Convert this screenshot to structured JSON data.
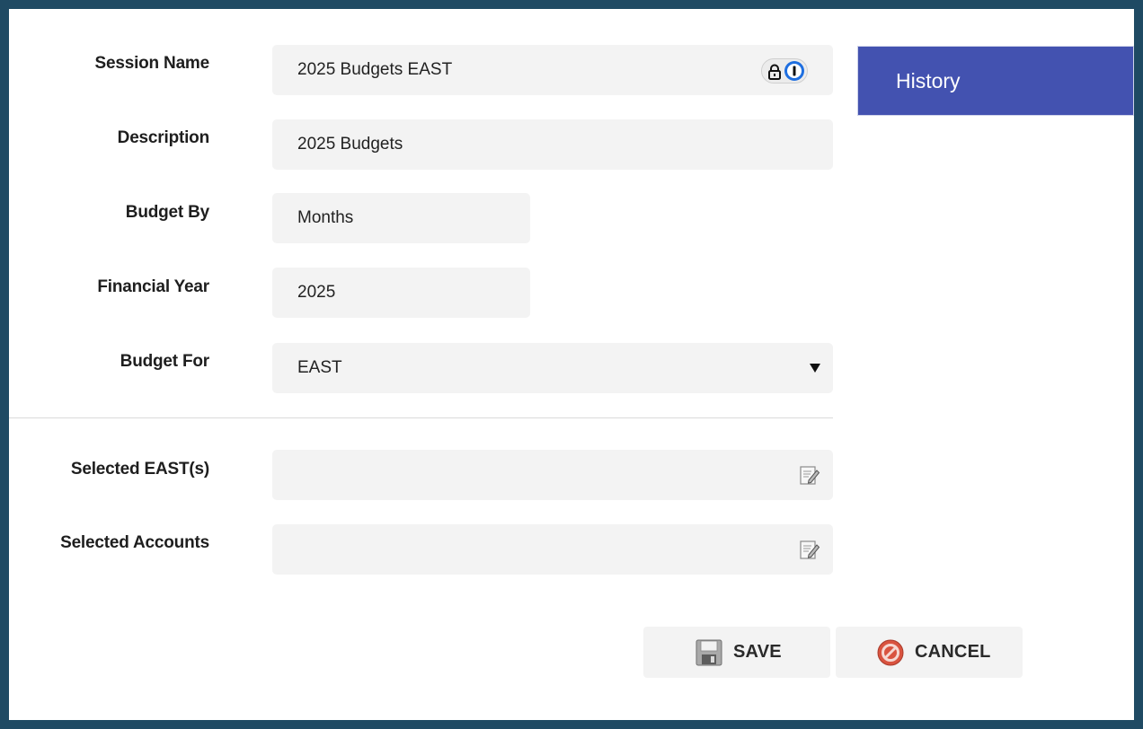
{
  "form": {
    "session_name": {
      "label": "Session Name",
      "value": "2025 Budgets EAST"
    },
    "description": {
      "label": "Description",
      "value": "2025 Budgets"
    },
    "budget_by": {
      "label": "Budget By",
      "value": "Months"
    },
    "financial_year": {
      "label": "Financial Year",
      "value": "2025"
    },
    "budget_for": {
      "label": "Budget For",
      "value": "EAST"
    },
    "selected_east": {
      "label": "Selected EAST(s)",
      "value": ""
    },
    "selected_accounts": {
      "label": "Selected Accounts",
      "value": ""
    }
  },
  "history": {
    "label": "History"
  },
  "buttons": {
    "save": "SAVE",
    "cancel": "CANCEL"
  },
  "icons": {
    "password_manager": "lock-password-manager-icon",
    "dropdown": "chevron-down-icon",
    "edit": "edit-icon",
    "save": "floppy-disk-icon",
    "cancel": "no-entry-icon"
  },
  "colors": {
    "frame": "#1f4a63",
    "accent": "#4352b0",
    "field_bg": "#f3f3f3"
  }
}
